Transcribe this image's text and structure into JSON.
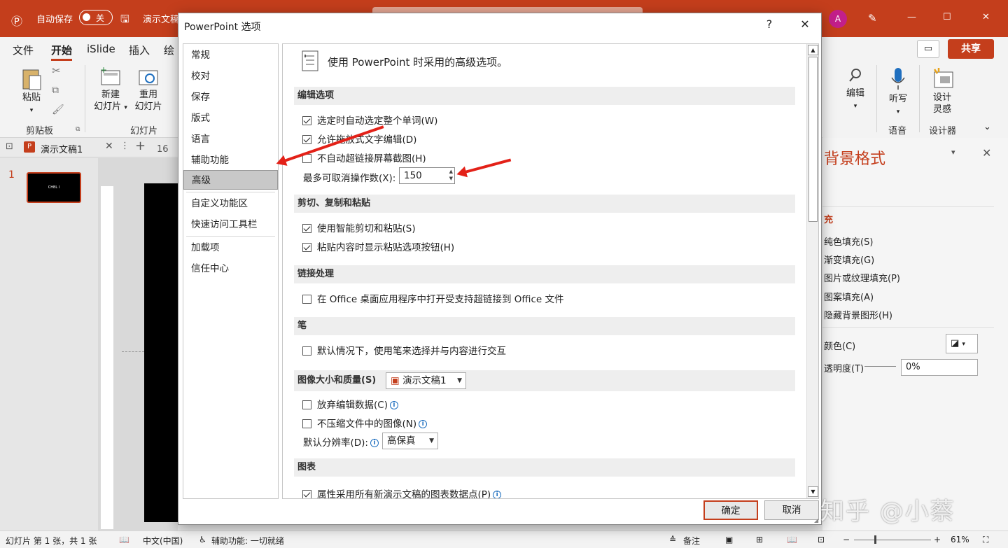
{
  "titlebar": {
    "autosave": "自动保存",
    "toggle": "关",
    "doc_title": "演示文稿",
    "avatar": "A",
    "minimize": "—",
    "maximize": "☐",
    "close": "✕"
  },
  "ribbon_tabs": {
    "file": "文件",
    "home": "开始",
    "islide": "iSlide",
    "insert": "插入",
    "draw": "绘",
    "share": "共享"
  },
  "ribbon": {
    "paste": "粘贴",
    "clipboard_group": "剪贴板",
    "new_slide_1": "新建",
    "new_slide_2": "幻灯片",
    "reuse_1": "重用",
    "reuse_2": "幻灯片",
    "slides_group": "幻灯片",
    "edit": "编辑",
    "dictate": "听写",
    "designer_1": "设计",
    "designer_2": "灵感",
    "voice_group": "语音",
    "designer_group": "设计器"
  },
  "doctab": {
    "name": "演示文稿1",
    "ruler_num": "16"
  },
  "thumbs": {
    "number": "1",
    "thumb_text": "CHBL I"
  },
  "right_pane": {
    "title": "背景格式",
    "fill_header": "充",
    "solid": "纯色填充(S)",
    "gradient": "渐变填充(G)",
    "picture": "图片或纹理填充(P)",
    "pattern": "图案填充(A)",
    "hide": "隐藏背景图形(H)",
    "color": "颜色(C)",
    "transparency": "透明度(T)",
    "transparency_value": "0%"
  },
  "dialog": {
    "title": "PowerPoint 选项",
    "help": "?",
    "close": "✕",
    "nav": [
      "常规",
      "校对",
      "保存",
      "版式",
      "语言",
      "辅助功能",
      "高级",
      "自定义功能区",
      "快速访问工具栏",
      "加载项",
      "信任中心"
    ],
    "selected_nav": "高级",
    "header": "使用 PowerPoint 时采用的高级选项。",
    "sections": {
      "editing": "编辑选项",
      "cut_copy": "剪切、复制和粘贴",
      "links": "链接处理",
      "pen": "笔",
      "image_size": "图像大小和质量(S)",
      "chart": "图表"
    },
    "options": {
      "select_whole_word": "选定时自动选定整个单词(W)",
      "drag_drop": "允许拖放式文字编辑(D)",
      "no_hyperlink": "不自动超链接屏幕截图(H)",
      "undo_label": "最多可取消操作数(X):",
      "undo_value": "150",
      "smart_cut": "使用智能剪切和粘贴(S)",
      "paste_options": "粘贴内容时显示粘贴选项按钮(H)",
      "office_links": "在 Office 桌面应用程序中打开受支持超链接到 Office 文件",
      "pen_default": "默认情况下，使用笔来选择并与内容进行交互",
      "image_doc": "演示文稿1",
      "discard_edit": "放弃编辑数据(C)",
      "no_compress": "不压缩文件中的图像(N)",
      "resolution_label": "默认分辨率(D):",
      "resolution_value": "高保真",
      "chart_data": "属性采用所有新演示文稿的图表数据点(P)"
    },
    "ok": "确定",
    "cancel": "取消"
  },
  "statusbar": {
    "slide_info": "幻灯片 第 1 张，共 1 张",
    "language": "中文(中国)",
    "accessibility": "辅助功能: 一切就绪",
    "notes": "备注",
    "zoom": "61%"
  },
  "watermark": "知乎 @小蔡",
  "colors": {
    "accent": "#c43e1c",
    "arrow": "#e32118"
  }
}
